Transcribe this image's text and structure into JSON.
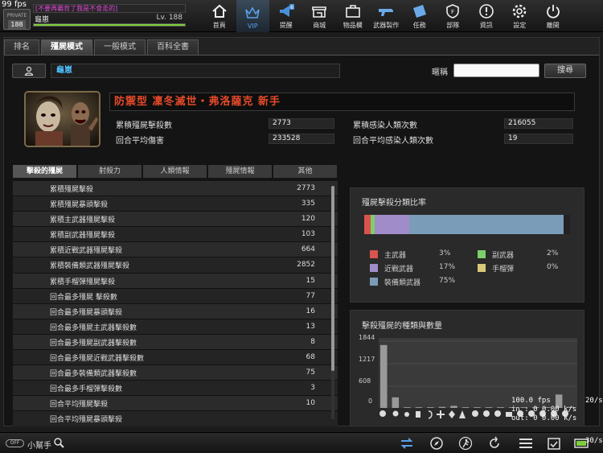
{
  "top": {
    "fps": "99 fps",
    "level_badge": "188",
    "motto": "[不要再霸背了我是不會走的]",
    "name": "龜崽",
    "level": "Lv. 188",
    "exp_fill_pct": 100
  },
  "nav": [
    {
      "label": "首頁",
      "icon": "home-icon"
    },
    {
      "label": "VIP",
      "icon": "crown-icon"
    },
    {
      "label": "提醒",
      "icon": "megaphone-icon",
      "badge": "6"
    },
    {
      "label": "商城",
      "icon": "shop-icon"
    },
    {
      "label": "物品欄",
      "icon": "bag-icon"
    },
    {
      "label": "武器製作",
      "icon": "gun-icon"
    },
    {
      "label": "任務",
      "icon": "ticket-icon"
    },
    {
      "label": "部隊",
      "icon": "shield-icon"
    },
    {
      "label": "資訊",
      "icon": "info-icon"
    },
    {
      "label": "設定",
      "icon": "gear-icon"
    },
    {
      "label": "離開",
      "icon": "power-icon"
    }
  ],
  "tabs": [
    "排名",
    "殭屍模式",
    "一般模式",
    "百科全書"
  ],
  "search": {
    "name_value": "龜崽",
    "nick_label": "暱稱",
    "nick_placeholder": "",
    "button": "搜尋"
  },
  "profile": {
    "title": "防禦型 凜冬滅世・弗洛薩克 新手",
    "stats": [
      {
        "label": "累積殭屍擊殺數",
        "value": "2773"
      },
      {
        "label": "累積感染人類次數",
        "value": "216055"
      },
      {
        "label": "回合平均傷害",
        "value": "233528"
      },
      {
        "label": "回合平均感染人類次數",
        "value": "19"
      }
    ]
  },
  "sub_tabs": [
    "擊殺的殭屍",
    "射殺力",
    "人類情報",
    "殭屍情報",
    "其他"
  ],
  "kill_stats": [
    {
      "label": "累積殭屍擊殺",
      "value": "2773"
    },
    {
      "label": "累積殭屍暴頭擊殺",
      "value": "335"
    },
    {
      "label": "累積主武器殭屍擊殺",
      "value": "120"
    },
    {
      "label": "累積副武器殭屍擊殺",
      "value": "103"
    },
    {
      "label": "累積近戰武器殭屍擊殺",
      "value": "664"
    },
    {
      "label": "累積裝備類武器殭屍擊殺",
      "value": "2852"
    },
    {
      "label": "累積手榴彈殭屍擊殺",
      "value": "15"
    },
    {
      "label": "回合最多殭屍 擊殺數",
      "value": "77"
    },
    {
      "label": "回合最多殭屍暴頭擊殺",
      "value": "16"
    },
    {
      "label": "回合最多殭屍主武器擊殺數",
      "value": "13"
    },
    {
      "label": "回合最多殭屍副武器擊殺數",
      "value": "8"
    },
    {
      "label": "回合最多殭屍近戰武器擊殺數",
      "value": "68"
    },
    {
      "label": "回合最多裝備類武器擊殺數",
      "value": "75"
    },
    {
      "label": "回合最多手榴彈擊殺數",
      "value": "3"
    },
    {
      "label": "回合平均殭屍擊殺",
      "value": "10"
    },
    {
      "label": "回合平均殭屍暴頭擊殺",
      "value": ""
    }
  ],
  "ratio_panel": {
    "title": "殭屍擊殺分類比率",
    "segments": [
      {
        "name": "主武器",
        "pct": 3,
        "pct_label": "3%",
        "color": "#d9534f"
      },
      {
        "name": "副武器",
        "pct": 2,
        "pct_label": "2%",
        "color": "#7bd06a"
      },
      {
        "name": "近戰武器",
        "pct": 17,
        "pct_label": "17%",
        "color": "#a08cc8"
      },
      {
        "name": "手榴彈",
        "pct": 0,
        "pct_label": "0%",
        "color": "#d8c87a"
      },
      {
        "name": "裝備類武器",
        "pct": 75,
        "pct_label": "75%",
        "color": "#7a9cb8"
      }
    ]
  },
  "chart_data": {
    "type": "bar",
    "title": "擊殺殭屍的種類與數量",
    "yticks": [
      "1844",
      "1217",
      "608",
      "0"
    ],
    "ylim": [
      0,
      1844
    ],
    "values": [
      1780,
      300,
      20,
      20,
      20,
      30,
      60,
      20,
      20,
      20,
      20,
      20,
      20,
      20,
      20,
      380,
      30
    ],
    "bar_color": "#999999"
  },
  "bottom": {
    "helper_label": "小幫手",
    "toggle_text": "OFF"
  },
  "debug": {
    "line1": "100.0 fps",
    "line2": "in : 0 0.00 k/s",
    "line3": "out: 0 0.00 k/s",
    "fps_mid": "20/s",
    "fps_bot": "30/s"
  }
}
